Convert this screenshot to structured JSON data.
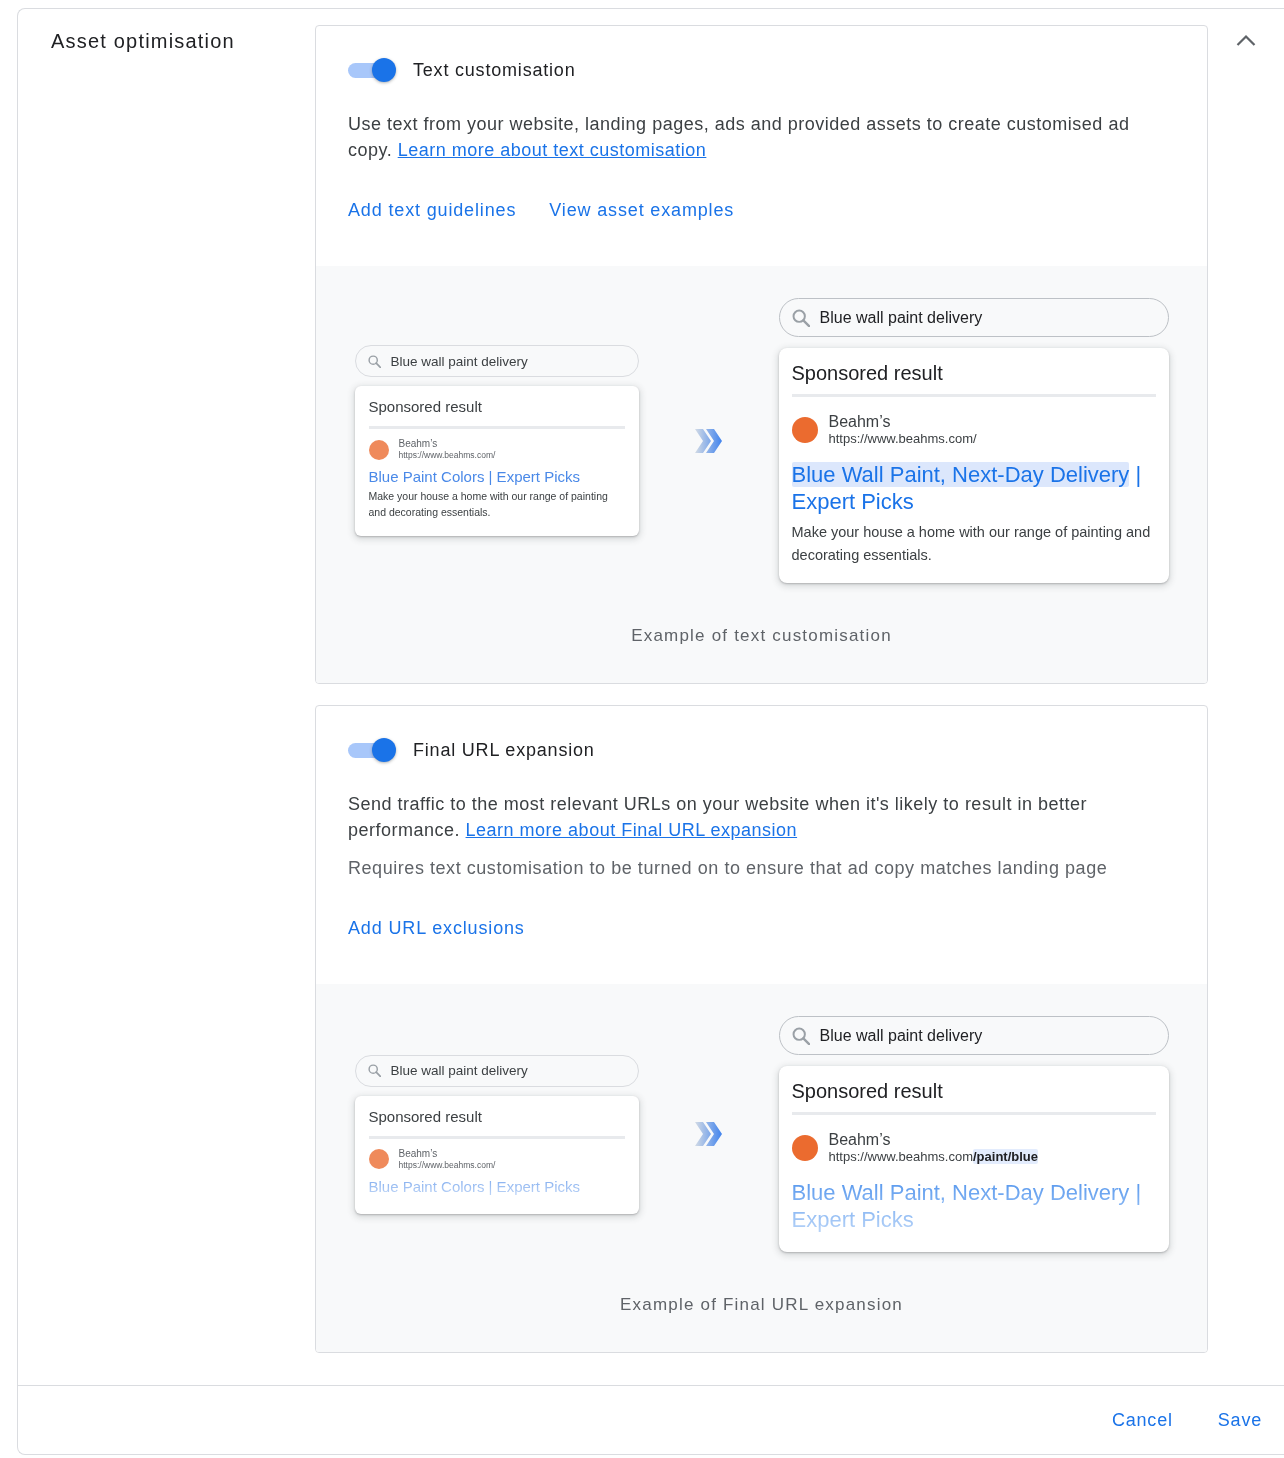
{
  "section": {
    "title": "Asset optimisation",
    "expanded": true
  },
  "options": [
    {
      "title": "Text customisation",
      "on": true,
      "description": "Use text from your website, landing pages, ads and provided assets to create customised ad copy.",
      "learn_more": "Learn more about text customisation",
      "links": [
        "Add text guidelines",
        "View asset examples"
      ],
      "example": {
        "previews": [
          {
            "kind": "compact",
            "query": "Blue wall paint delivery",
            "label": "Sponsored result",
            "advertiser": "Beahm’s",
            "url": "https://www.beahms.com/",
            "headline": [
              {
                "text": "Blue Paint Colors | Expert Picks",
                "highlighted": false
              }
            ],
            "description": "Make your house a home with our range of painting and decorating essentials.",
            "clipped": false
          },
          {
            "kind": "full",
            "query": "Blue wall paint delivery",
            "label": "Sponsored result",
            "advertiser": "Beahm’s",
            "url": "https://www.beahms.com/",
            "headline": [
              {
                "text": "Blue Wall Paint, Next-Day Delivery",
                "highlighted": true
              },
              {
                "text": " | Expert Picks",
                "highlighted": false
              }
            ],
            "description": "Make your house a home with our range of painting and decorating essentials.",
            "clipped": false
          }
        ],
        "caption": "Example of text customisation"
      }
    },
    {
      "title": "Final URL expansion",
      "on": true,
      "description": "Send traffic to the most relevant URLs on your website when it's likely to result in better performance.",
      "learn_more": "Learn more about Final URL expansion",
      "note": "Requires text customisation to be turned on to ensure that ad copy matches landing page",
      "links": [
        "Add URL exclusions"
      ],
      "example": {
        "previews": [
          {
            "kind": "compact",
            "query": "Blue wall paint delivery",
            "label": "Sponsored result",
            "advertiser": "Beahm’s",
            "url": "https://www.beahms.com/",
            "headline": [
              {
                "text": "Blue Paint Colors | Expert Picks",
                "highlighted": false
              }
            ],
            "clipped": true
          },
          {
            "kind": "full",
            "query": "Blue wall paint delivery",
            "label": "Sponsored result",
            "advertiser": "Beahm’s",
            "url": "https://www.beahms.com**/paint/blue**",
            "headline": [
              {
                "text": "Blue Wall Paint, Next-Day Delivery | Expert Picks",
                "highlighted": false
              }
            ],
            "clipped": true
          }
        ],
        "caption": "Example of Final URL expansion"
      }
    }
  ],
  "footer": {
    "buttons": [
      "Cancel",
      "Save"
    ]
  }
}
